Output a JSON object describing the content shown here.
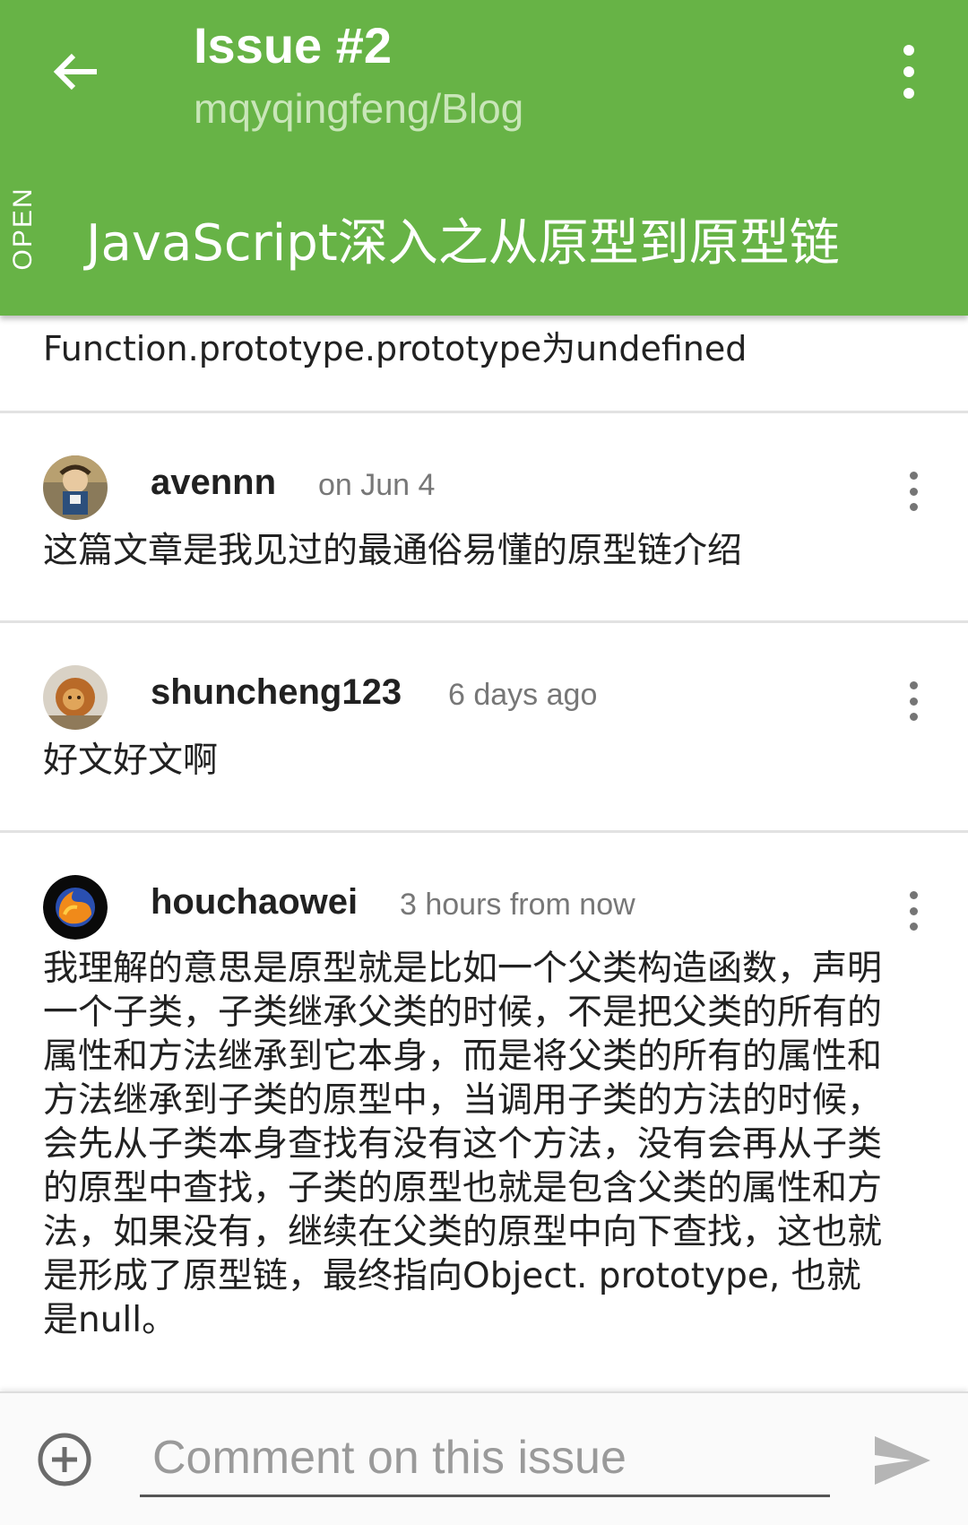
{
  "header": {
    "title": "Issue #2",
    "subtitle": "mqyqingfeng/Blog",
    "state": "OPEN",
    "issue_title": "JavaScript深入之从原型到原型链"
  },
  "partial_comment": {
    "text": "Function.prototype.prototype为undefined"
  },
  "comments": [
    {
      "author": "avennn",
      "time": "on Jun 4",
      "body": "这篇文章是我见过的最通俗易懂的原型链介绍"
    },
    {
      "author": "shuncheng123",
      "time": "6 days ago",
      "body": "好文好文啊"
    },
    {
      "author": "houchaowei",
      "time": "3 hours from now",
      "body": "我理解的意思是原型就是比如一个父类构造函数，声明一个子类，子类继承父类的时候，不是把父类的所有的属性和方法继承到它本身，而是将父类的所有的属性和方法继承到子类的原型中，当调用子类的方法的时候，会先从子类本身查找有没有这个方法，没有会再从子类的原型中查找，子类的原型也就是包含父类的属性和方法，如果没有，继续在父类的原型中向下查找，这也就是形成了原型链，最终指向Object. prototype, 也就是null。"
    }
  ],
  "composer": {
    "placeholder": "Comment on this issue"
  },
  "colors": {
    "appbar": "#67b346",
    "subtitle": "#c9e6b9"
  },
  "icons": {
    "back": "arrow-left-icon",
    "overflow": "more-vert-icon",
    "add": "add-circle-icon",
    "send": "send-icon"
  }
}
